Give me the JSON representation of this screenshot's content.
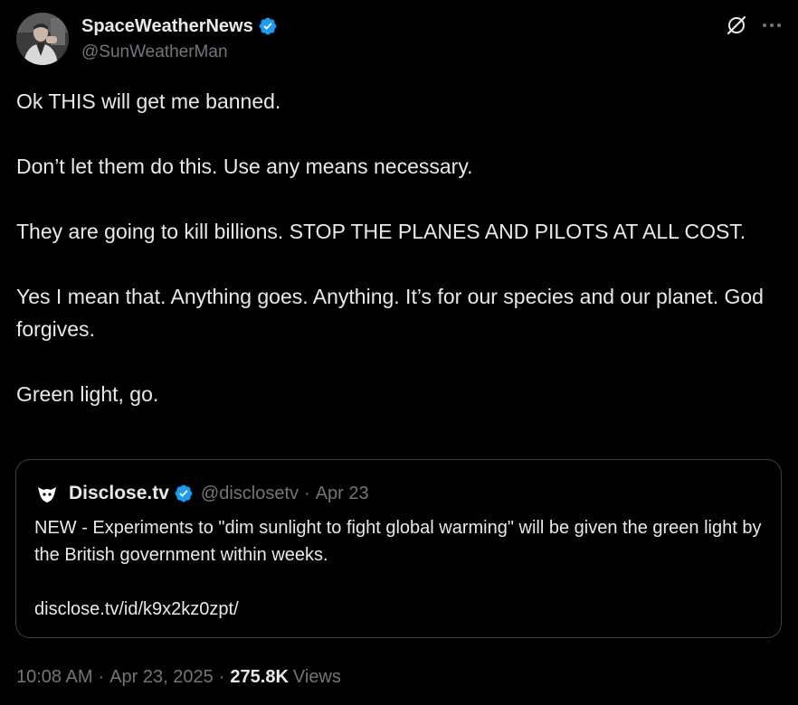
{
  "colors": {
    "background": "#000000",
    "text_primary": "#e7e9ea",
    "text_secondary": "#71767b",
    "verified_blue": "#1d9bf0",
    "border": "#3a3d42"
  },
  "author": {
    "display_name": "SpaceWeatherNews",
    "handle": "@SunWeatherMan",
    "verified": true,
    "avatar_icon": "profile-photo"
  },
  "header_actions": {
    "grok_icon": "grok-icon",
    "more_icon": "more-icon"
  },
  "tweet": {
    "paragraphs": [
      "Ok THIS will get me banned.",
      "Don’t let them do this. Use any means necessary.",
      "They are going to kill billions. STOP THE PLANES AND PILOTS AT ALL COST.",
      "Yes I mean that. Anything goes. Anything. It’s for our species and our planet. God forgives.",
      "Green light, go."
    ]
  },
  "quote": {
    "display_name": "Disclose.tv",
    "handle": "@disclosetv",
    "separator": "·",
    "date": "Apr 23",
    "verified": true,
    "logo_icon": "disclose-logo-icon",
    "text": "NEW - Experiments to \"dim sunlight to fight global warming\" will be given the green light by the British government within weeks.",
    "link": "disclose.tv/id/k9x2kz0zpt/"
  },
  "meta": {
    "time": "10:08 AM",
    "separator": "·",
    "date": "Apr 23, 2025",
    "views_count": "275.8K",
    "views_label": "Views"
  }
}
